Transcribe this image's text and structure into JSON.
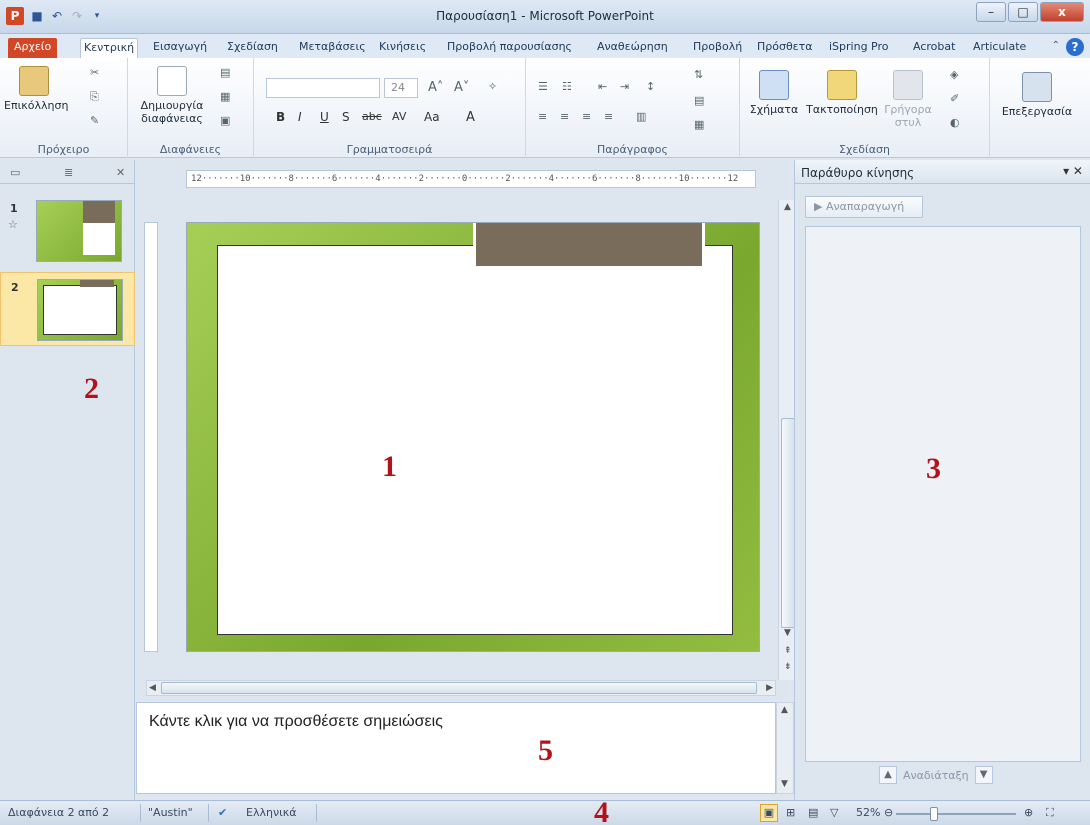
{
  "window": {
    "title": "Παρουσίαση1 - Microsoft PowerPoint",
    "minimize": "–",
    "maximize": "□",
    "close": "x"
  },
  "ribbon_tabs": [
    "Αρχείο",
    "Κεντρική",
    "Εισαγωγή",
    "Σχεδίαση",
    "Μεταβάσεις",
    "Κινήσεις",
    "Προβολή παρουσίασης",
    "Αναθεώρηση",
    "Προβολή",
    "Πρόσθετα",
    "iSpring Pro",
    "Acrobat",
    "Articulate"
  ],
  "ribbon": {
    "paste_label": "Επικόλληση",
    "new_slide_label": "Δημιουργία διαφάνειας",
    "font_size": "24",
    "shapes_label": "Σχήματα",
    "arrange_label": "Τακτοποίηση",
    "quick_styles_label": "Γρήγορα στυλ",
    "editing_label": "Επεξεργασία",
    "groups": {
      "clipboard": "Πρόχειρο",
      "slides": "Διαφάνειες",
      "font": "Γραμματοσειρά",
      "paragraph": "Παράγραφος",
      "drawing": "Σχεδίαση"
    }
  },
  "thumbnails": [
    {
      "number": "1"
    },
    {
      "number": "2"
    }
  ],
  "ruler_text": "12·······10·······8·······6·······4·······2·······0·······2·······4·······6·······8·······10·······12",
  "notes": {
    "placeholder": "Κάντε κλικ για να προσθέσετε σημειώσεις"
  },
  "animation_pane": {
    "title": "Παράθυρο κίνησης",
    "play_label": "Αναπαραγωγή",
    "reorder_label": "Αναδιάταξη"
  },
  "status": {
    "slide_info": "Διαφάνεια 2 από 2",
    "theme": "\"Austin\"",
    "language": "Ελληνικά",
    "zoom": "52%"
  },
  "annotations": {
    "a1": "1",
    "a2": "2",
    "a3": "3",
    "a4": "4",
    "a5": "5"
  }
}
